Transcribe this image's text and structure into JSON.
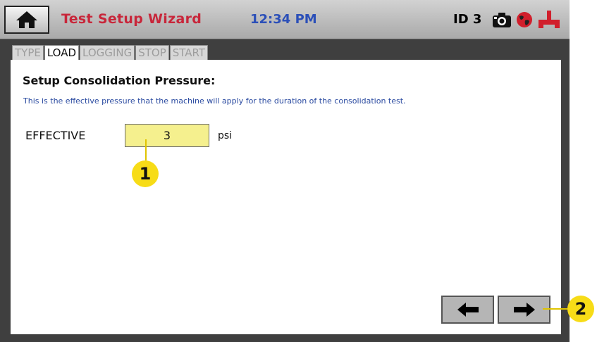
{
  "header": {
    "title": "Test Setup Wizard",
    "time": "12:34 PM",
    "id_label": "ID 3",
    "icons": [
      "home-icon",
      "camera-icon",
      "globe-icon",
      "connection-icon"
    ]
  },
  "tabs": [
    {
      "label": "TYPE",
      "active": false
    },
    {
      "label": "LOAD",
      "active": true
    },
    {
      "label": "LOGGING",
      "active": false
    },
    {
      "label": "STOP",
      "active": false
    },
    {
      "label": "START",
      "active": false
    }
  ],
  "main": {
    "heading": "Setup Consolidation Pressure:",
    "description": "This is the effective pressure that the machine will apply for the duration of the consolidation test.",
    "field_label": "EFFECTIVE",
    "field_value": "3",
    "unit": "psi"
  },
  "nav": {
    "back_icon": "arrow-left-icon",
    "next_icon": "arrow-right-icon"
  },
  "callouts": [
    "1",
    "2"
  ],
  "colors": {
    "title": "#c8263a",
    "clock": "#2b4fb8",
    "description": "#2a4aa0",
    "input_bg": "#f5f08e",
    "callout": "#f7dc17"
  }
}
